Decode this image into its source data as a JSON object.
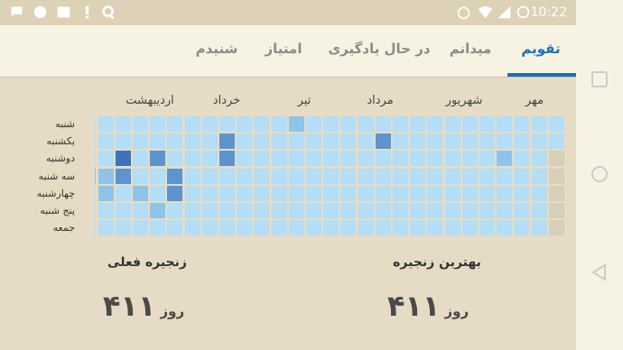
{
  "status_bar": {
    "time": "10:22"
  },
  "tabs": [
    {
      "label": "تقویم",
      "active": true
    },
    {
      "label": "میدانم",
      "active": false
    },
    {
      "label": "در حال یادگیری",
      "active": false
    },
    {
      "label": "امتیاز",
      "active": false
    },
    {
      "label": "شنیدم",
      "active": false
    }
  ],
  "calendar": {
    "months": [
      "مهر",
      "شهریور",
      "مرداد",
      "تیر",
      "خرداد",
      "اردیبهشت"
    ],
    "days": [
      "شنبه",
      "یکشنبه",
      "دوشنبه",
      "سه شنبه",
      "چهارشنبه",
      "پنج شنبه",
      "جمعه"
    ],
    "colors": {
      "0": "#b3def6",
      "1": "#8ec4ea",
      "2": "#5b94cf",
      "3": "#3d73b8",
      "4": "#d8cfb8"
    },
    "rows": [
      "0000000000000001000000000000103",
      "0000000000200000000200000000200",
      "0001000000000000000200020300000",
      "0000000000000000000000200211000",
      "0000000000000000000000201010010",
      "0000000000000000000000010000003",
      "0000000000000000000000000000000"
    ],
    "future": [
      "0000000000000000000000000000000",
      "0000000000000000000000000000000",
      "4000000000000000000000000000000",
      "4000000000000000000000000000000",
      "4000000000000000000000000000000",
      "4000000000000000000000000000000",
      "4000000000000000000000000000001"
    ]
  },
  "stats": {
    "best_streak": {
      "label": "بهترین زنجیره",
      "value": "۴۱۱",
      "unit": "روز"
    },
    "current_streak": {
      "label": "زنجیره فعلی",
      "value": "۴۱۱",
      "unit": "روز"
    }
  }
}
